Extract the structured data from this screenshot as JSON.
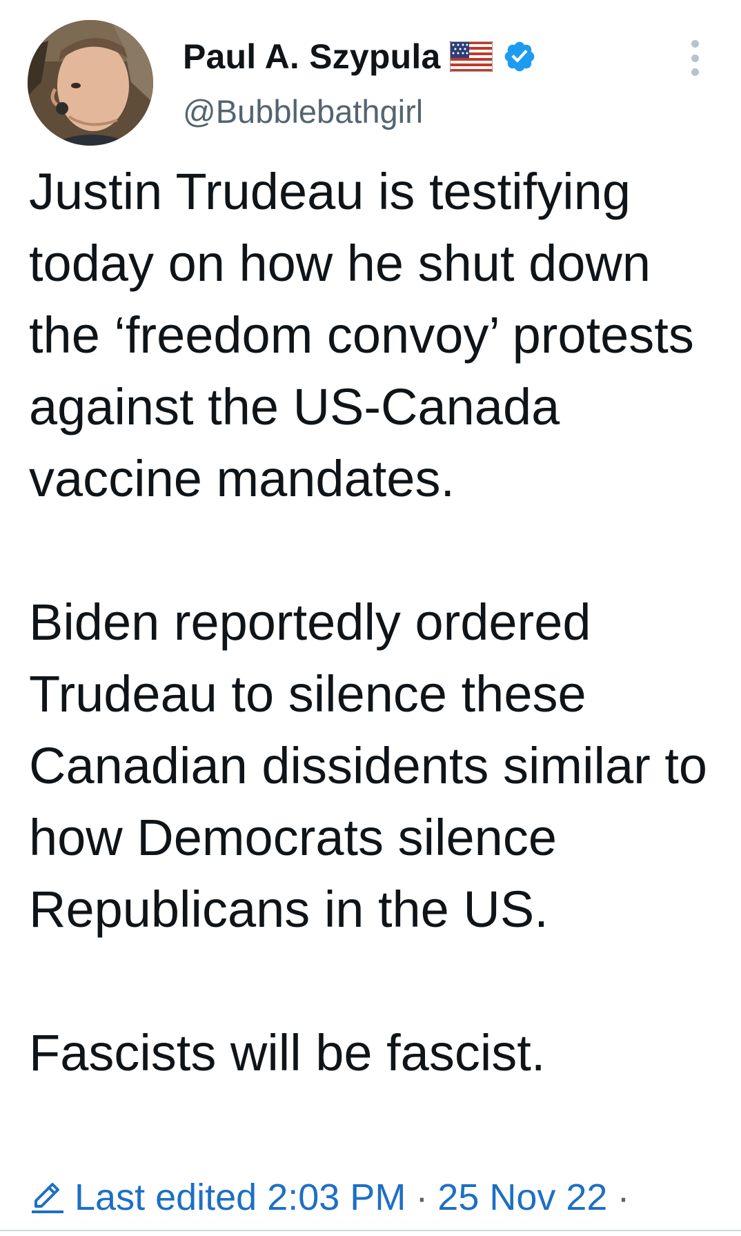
{
  "author": {
    "display_name": "Paul A. Szypula",
    "handle": "@Bubblebathgirl",
    "badges": [
      "us-flag-icon",
      "verified-icon"
    ]
  },
  "tweet": {
    "text": "Justin Trudeau is testifying today on how he shut down the ‘freedom convoy’ protests against the US-Canada vaccine mandates.\n\nBiden reportedly ordered Trudeau to silence these Canadian dissidents similar to how Democrats silence Republicans in the US.\n\nFascists will be fascist."
  },
  "meta": {
    "edit_icon": "pencil-icon",
    "edited_label": "Last edited 2:03 PM",
    "separator": "·",
    "date": "25 Nov 22",
    "trailing_separator": "·"
  },
  "colors": {
    "text": "#0f1419",
    "secondary": "#536471",
    "link": "#1d6fc4",
    "verified": "#1d9bf0"
  }
}
